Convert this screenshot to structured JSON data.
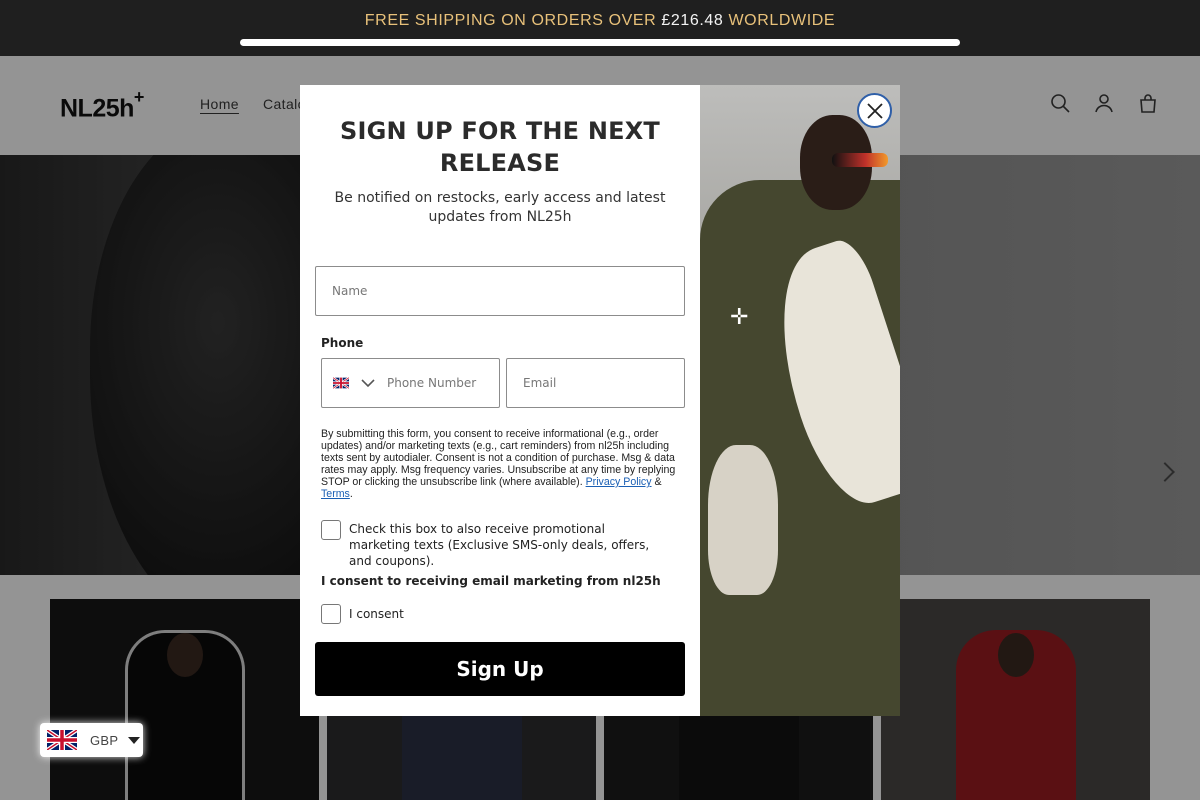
{
  "announcement": {
    "text_before": "FREE SHIPPING ON ORDERS OVER ",
    "amount": "£216.48",
    "text_after": " WORLDWIDE",
    "progress_fraction": 1.0
  },
  "header": {
    "logo": "NL25h",
    "logo_mark": "+",
    "nav": [
      {
        "label": "Home",
        "active": true
      },
      {
        "label": "Catalog",
        "active": false
      }
    ],
    "icons": [
      "search-icon",
      "account-icon",
      "cart-icon"
    ]
  },
  "modal": {
    "title": "SIGN UP FOR THE NEXT RELEASE",
    "subtitle": "Be notified on restocks, early access and latest updates from NL25h",
    "name_placeholder": "Name",
    "phone_label": "Phone",
    "phone_placeholder": "Phone Number",
    "email_placeholder": "Email",
    "legal_text": "By submitting this form, you consent to receive informational (e.g., order updates) and/or marketing texts (e.g., cart reminders) from nl25h including texts sent by autodialer. Consent is not a condition of purchase. Msg & data rates may apply. Msg frequency varies. Unsubscribe at any time by replying STOP or clicking the unsubscribe link (where available).",
    "privacy_link": "Privacy Policy",
    "amp": "&",
    "terms_link": "Terms",
    "sms_checkbox_label": "Check this box to also receive promotional marketing texts (Exclusive SMS-only deals, offers, and coupons).",
    "email_consent_heading": "I consent to receiving email marketing from nl25h",
    "email_consent_label": "I consent",
    "submit_label": "Sign Up",
    "close_icon": "close-icon"
  },
  "currency": {
    "code": "GBP",
    "flag": "uk-flag-icon"
  },
  "colors": {
    "announcement_bg": "#1f1f1f",
    "announcement_text": "#e8c17a",
    "button_bg": "#000000",
    "close_ring": "#2f5fa8",
    "link": "#1a5fb4"
  }
}
